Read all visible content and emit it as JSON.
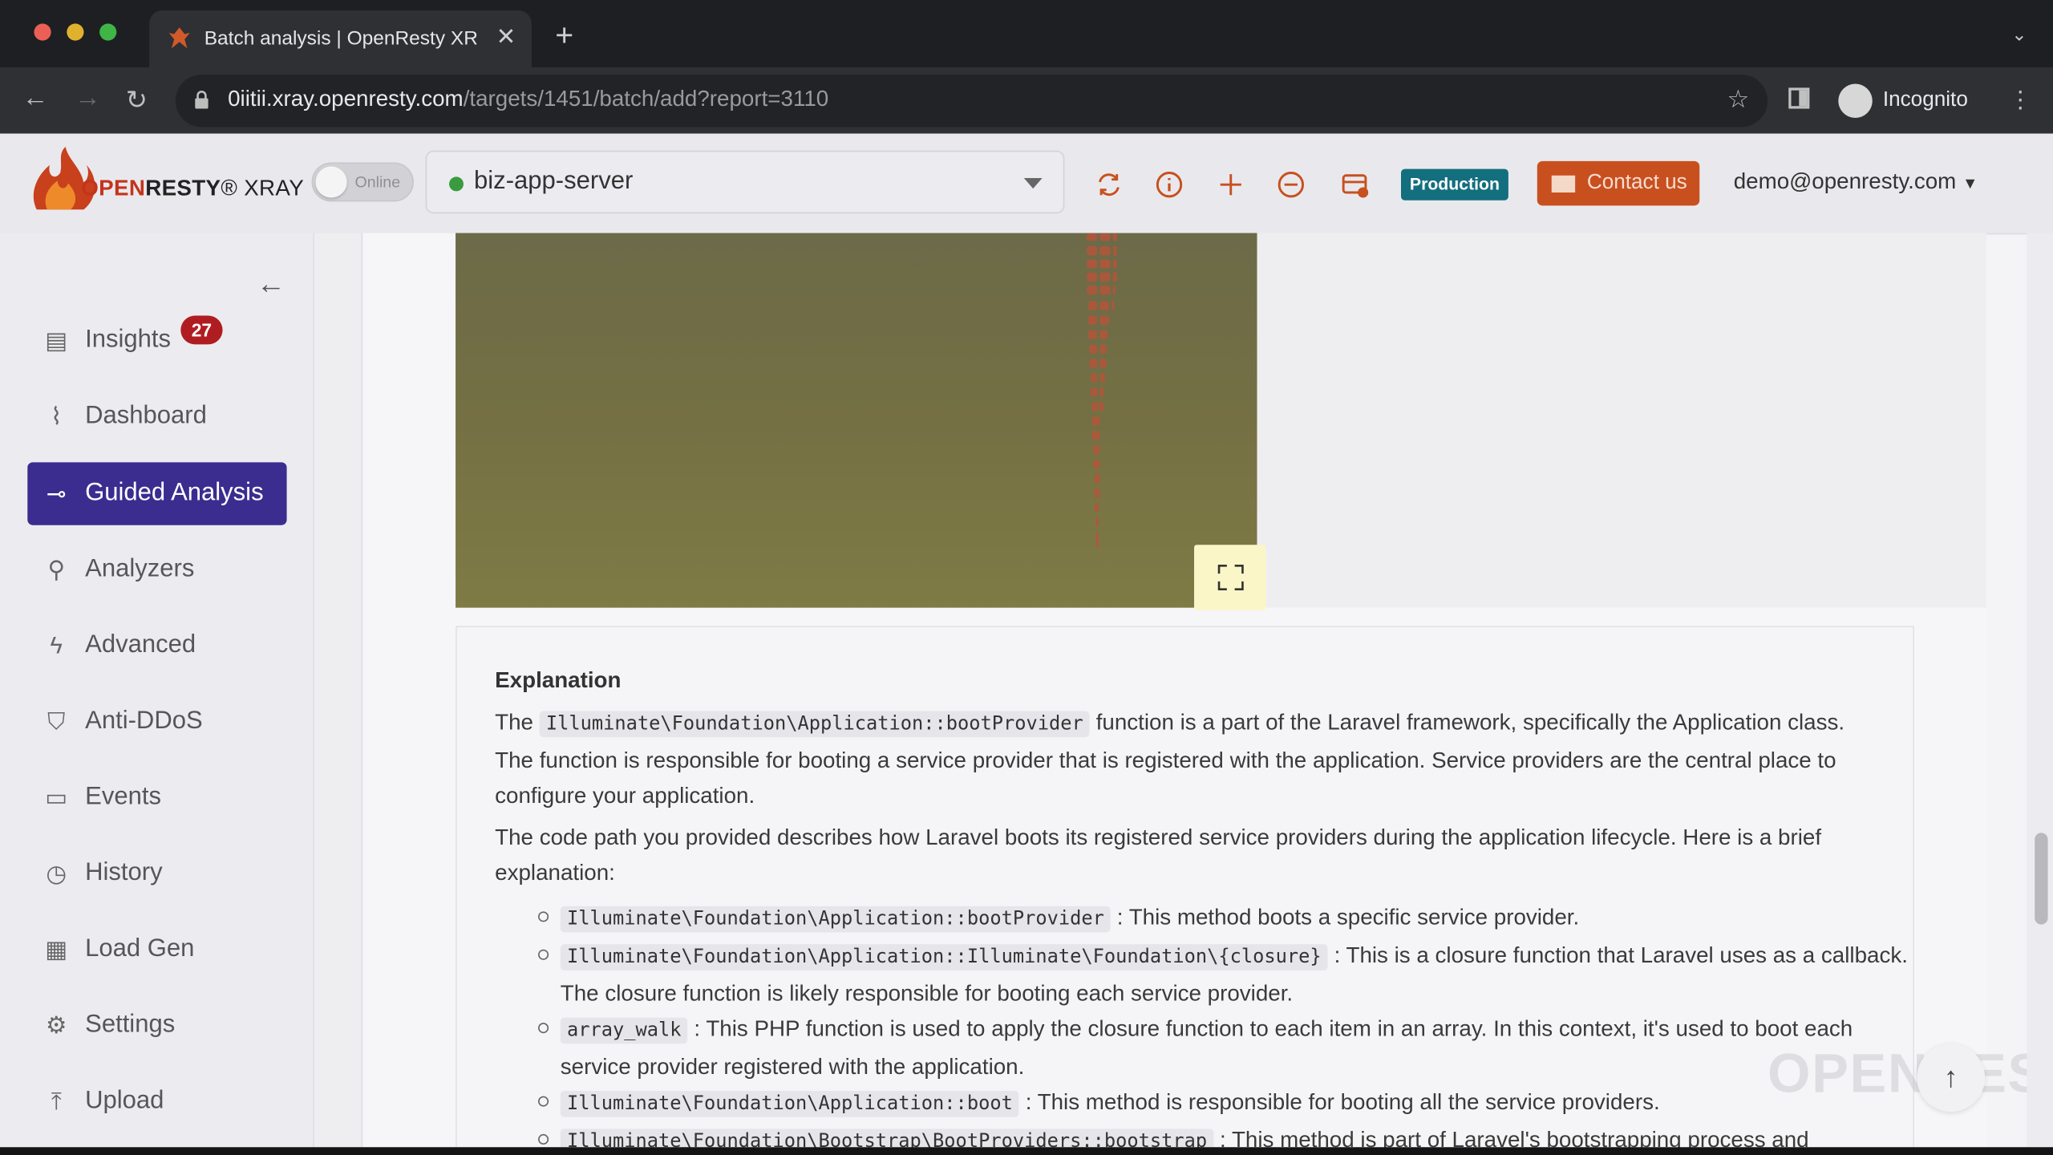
{
  "browser": {
    "tab_title": "Batch analysis | OpenResty XRay",
    "url_host": "0iitii.xray.openresty.com",
    "url_path": "/targets/1451/batch/add?report=3110",
    "profile_label": "Incognito"
  },
  "header": {
    "logo_text_1": "OPEN",
    "logo_text_2": "RESTY",
    "logo_text_3": "® XRAY",
    "toggle_label": "Online",
    "target_name": "biz-app-server",
    "env_badge": "Production",
    "contact_label": "Contact us",
    "user_email": "demo@openresty.com"
  },
  "sidebar": {
    "insights_badge": "27",
    "items": [
      {
        "label": "Insights",
        "icon": "document-icon"
      },
      {
        "label": "Dashboard",
        "icon": "line-chart-icon"
      },
      {
        "label": "Guided Analysis",
        "icon": "guided-icon"
      },
      {
        "label": "Analyzers",
        "icon": "search-icon"
      },
      {
        "label": "Advanced",
        "icon": "bolt-icon"
      },
      {
        "label": "Anti-DDoS",
        "icon": "shield-icon"
      },
      {
        "label": "Events",
        "icon": "calendar-icon"
      },
      {
        "label": "History",
        "icon": "clock-icon"
      },
      {
        "label": "Load Gen",
        "icon": "file-gear-icon"
      },
      {
        "label": "Settings",
        "icon": "gear-icon"
      },
      {
        "label": "Upload",
        "icon": "upload-icon"
      }
    ]
  },
  "content": {
    "explanation_title": "Explanation",
    "p1_pre": "The",
    "p1_code": "Illuminate\\Foundation\\Application::bootProvider",
    "p1_post": "function is a part of the Laravel framework, specifically the Application class. The function is responsible for booting a service provider that is registered with the application. Service providers are the central place to configure your application.",
    "p2": "The code path you provided describes how Laravel boots its registered service providers during the application lifecycle. Here is a brief explanation:",
    "bullets": [
      {
        "code": "Illuminate\\Foundation\\Application::bootProvider",
        "text": ": This method boots a specific service provider."
      },
      {
        "code": "Illuminate\\Foundation\\Application::Illuminate\\Foundation\\{closure}",
        "text": ": This is a closure function that Laravel uses as a callback. The closure function is likely responsible for booting each service provider."
      },
      {
        "code": "array_walk",
        "text": ": This PHP function is used to apply the closure function to each item in an array. In this context, it's used to boot each service provider registered with the application."
      },
      {
        "code": "Illuminate\\Foundation\\Application::boot",
        "text": ": This method is responsible for booting all the service providers."
      },
      {
        "code": "Illuminate\\Foundation\\Bootstrap\\BootProviders::bootstrap",
        "text": ": This method is part of Laravel's bootstrapping process and"
      }
    ],
    "watermark": "OPENRESTY"
  },
  "colors": {
    "accent": "#3b2c8f",
    "badge": "#b01d20",
    "production": "#136f7e",
    "contact": "#c8501f",
    "online_dot": "#3a9a40"
  }
}
